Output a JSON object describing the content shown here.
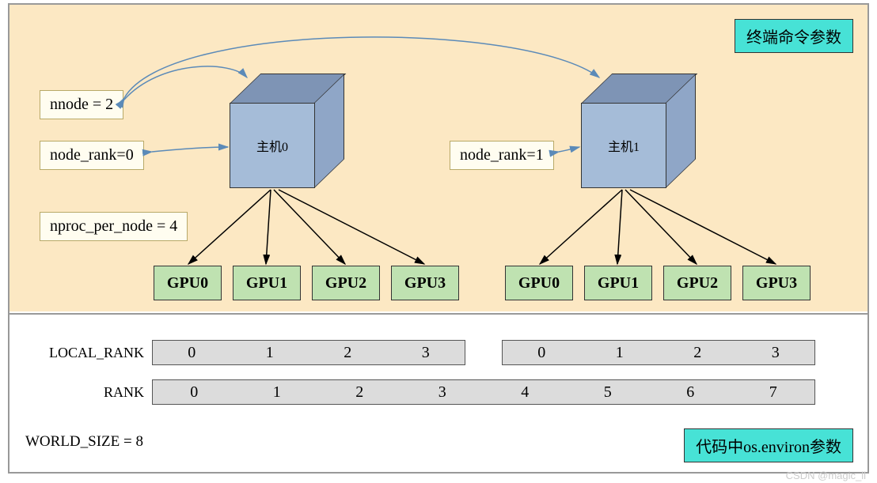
{
  "badges": {
    "top": "终端命令参数",
    "bottom": "代码中os.environ参数"
  },
  "labels": {
    "nnode": "nnode = 2",
    "noderank0": "node_rank=0",
    "nproc": "nproc_per_node = 4",
    "noderank1": "node_rank=1"
  },
  "cubes": {
    "host0": "主机0",
    "host1": "主机1"
  },
  "gpus": {
    "host0": [
      "GPU0",
      "GPU1",
      "GPU2",
      "GPU3"
    ],
    "host1": [
      "GPU0",
      "GPU1",
      "GPU2",
      "GPU3"
    ]
  },
  "bottom": {
    "local_rank_label": "LOCAL_RANK",
    "rank_label": "RANK",
    "world_size": "WORLD_SIZE = 8",
    "local_rank_host0": [
      "0",
      "1",
      "2",
      "3"
    ],
    "local_rank_host1": [
      "0",
      "1",
      "2",
      "3"
    ],
    "rank": [
      "0",
      "1",
      "2",
      "3",
      "4",
      "5",
      "6",
      "7"
    ]
  },
  "watermark": "CSDN @magic_ll",
  "chart_data": {
    "type": "diagram",
    "title": "PyTorch Distributed Training Parameters",
    "nnode": 2,
    "nproc_per_node": 4,
    "world_size": 8,
    "nodes": [
      {
        "name": "主机0",
        "node_rank": 0,
        "gpus": [
          "GPU0",
          "GPU1",
          "GPU2",
          "GPU3"
        ],
        "local_rank": [
          0,
          1,
          2,
          3
        ],
        "rank": [
          0,
          1,
          2,
          3
        ]
      },
      {
        "name": "主机1",
        "node_rank": 1,
        "gpus": [
          "GPU0",
          "GPU1",
          "GPU2",
          "GPU3"
        ],
        "local_rank": [
          0,
          1,
          2,
          3
        ],
        "rank": [
          4,
          5,
          6,
          7
        ]
      }
    ],
    "terminal_params": [
      "nnode",
      "node_rank",
      "nproc_per_node"
    ],
    "environ_params": [
      "LOCAL_RANK",
      "RANK",
      "WORLD_SIZE"
    ]
  }
}
